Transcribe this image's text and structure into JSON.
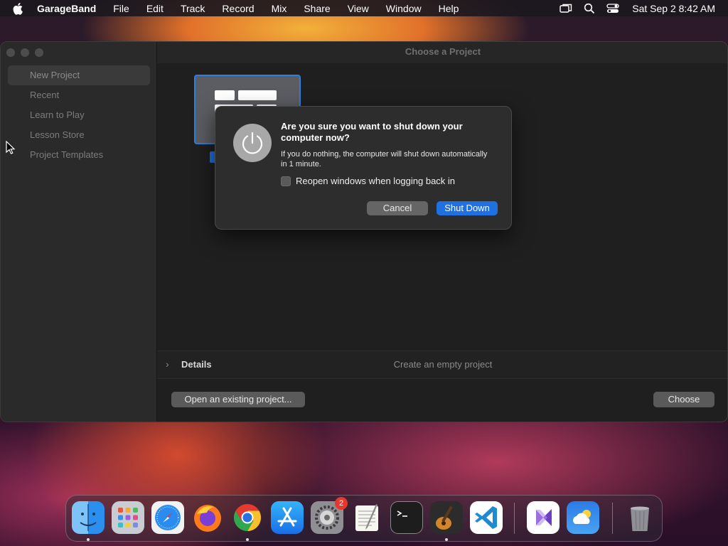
{
  "menubar": {
    "app_name": "GarageBand",
    "menus": [
      "File",
      "Edit",
      "Track",
      "Record",
      "Mix",
      "Share",
      "View",
      "Window",
      "Help"
    ],
    "clock": "Sat Sep 2  8:42 AM"
  },
  "window": {
    "title": "Choose a Project",
    "sidebar": {
      "items": [
        {
          "label": "New Project",
          "selected": true
        },
        {
          "label": "Recent"
        },
        {
          "label": "Learn to Play"
        },
        {
          "label": "Lesson Store"
        },
        {
          "label": "Project Templates"
        }
      ]
    },
    "details": {
      "label": "Details",
      "description": "Create an empty project"
    },
    "open_button": "Open an existing project...",
    "choose_button": "Choose"
  },
  "dialog": {
    "title": "Are you sure you want to shut down your computer now?",
    "message": "If you do nothing, the computer will shut down automatically in 1 minute.",
    "checkbox_label": "Reopen windows when logging back in",
    "checkbox_checked": false,
    "cancel_label": "Cancel",
    "confirm_label": "Shut Down"
  },
  "dock": {
    "apps": [
      {
        "name": "finder-icon",
        "running": true
      },
      {
        "name": "launchpad-icon"
      },
      {
        "name": "safari-icon"
      },
      {
        "name": "firefox-icon"
      },
      {
        "name": "chrome-icon",
        "running": true
      },
      {
        "name": "app-store-icon"
      },
      {
        "name": "system-settings-icon",
        "badge": "2"
      },
      {
        "name": "textedit-icon"
      },
      {
        "name": "terminal-icon"
      },
      {
        "name": "garageband-icon",
        "running": true
      },
      {
        "name": "vscode-icon"
      },
      {
        "name": "visual-studio-icon"
      },
      {
        "name": "weather-icon"
      },
      {
        "name": "trash-icon"
      }
    ]
  },
  "colors": {
    "accent": "#1f70e0",
    "badge": "#e5382e"
  }
}
